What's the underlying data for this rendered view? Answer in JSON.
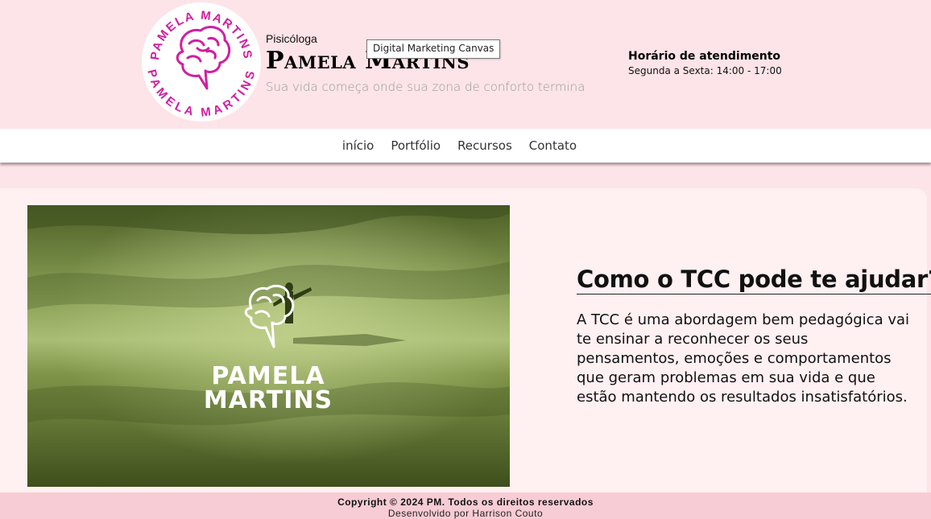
{
  "header": {
    "subtitle": "Pisicóloga",
    "brand_name": "Pamela Martins",
    "slogan": "Sua vida começa onde sua zona de conforto termina",
    "tooltip": "Digital Marketing Canvas",
    "logo_ring_text": "PAMELA MARTINS",
    "hours_title": "Horário de atendimento",
    "hours_text": "Segunda a Sexta: 14:00 - 17:00"
  },
  "nav": {
    "items": [
      {
        "label": "início"
      },
      {
        "label": "Portfólio"
      },
      {
        "label": "Recursos"
      },
      {
        "label": "Contato"
      }
    ]
  },
  "main": {
    "video_logo_text_line1": "PAMELA",
    "video_logo_text_line2": "MARTINS",
    "heading": "Como o TCC pode te ajudar?",
    "paragraph": "A TCC é uma abordagem bem pedagógica vai te ensinar a reconhecer os seus pensamentos, emoções e comportamentos que geram problemas em sua vida e que estão mantendo os resultados insatisfatórios."
  },
  "footer": {
    "copyright": "Copyright © 2024 PM. Todos os direitos reservados",
    "developer": "Desenvolvido por Harrison Couto"
  },
  "colors": {
    "background": "#fde4e8",
    "logo_magenta": "#d01fa0",
    "footer_bg": "#f8ccd4",
    "video_tint": "#6b8040"
  }
}
